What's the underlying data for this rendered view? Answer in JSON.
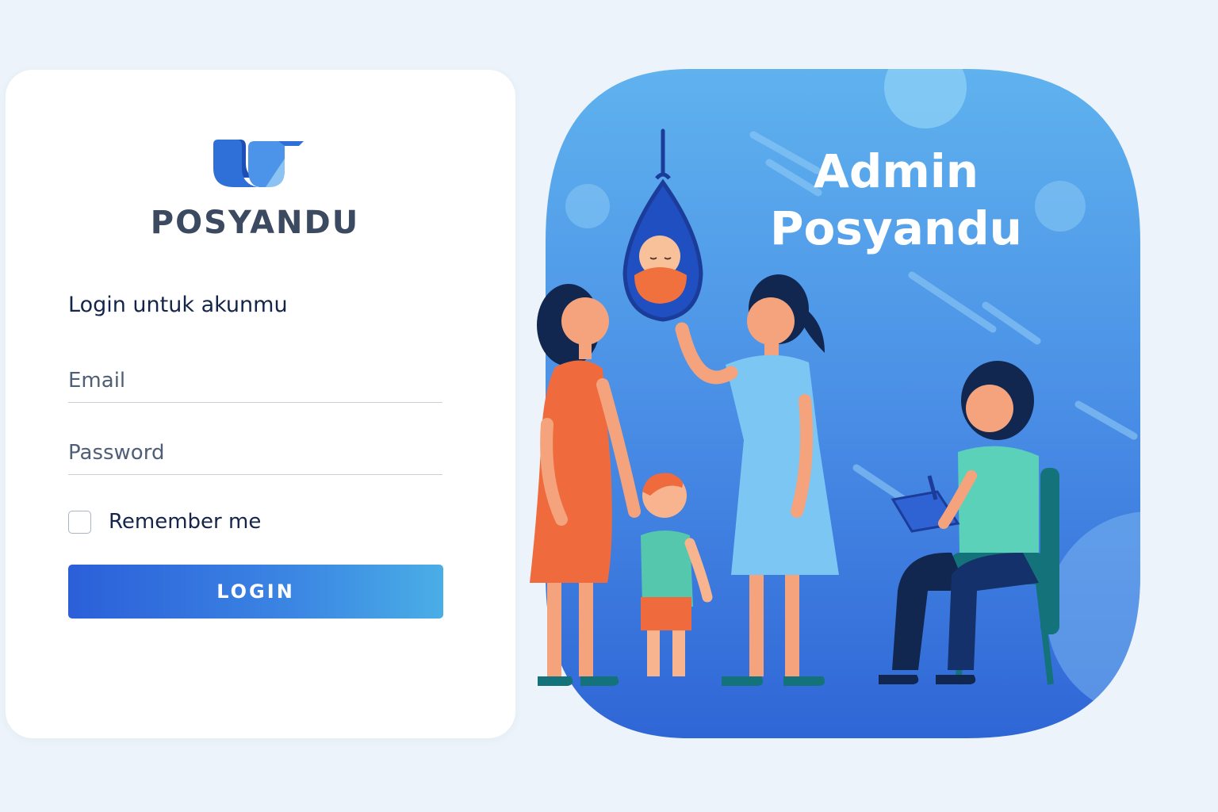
{
  "brand": {
    "name": "POSYANDU",
    "logo_icon": "posyandu-leaf-logo"
  },
  "form": {
    "subtitle": "Login untuk akunmu",
    "email_placeholder": "Email",
    "password_placeholder": "Password",
    "remember_label": "Remember me",
    "remember_checked": false,
    "login_label": "LOGIN"
  },
  "hero": {
    "title_line1": "Admin",
    "title_line2": "Posyandu",
    "illustration": "posyandu-family-weighing-illustration"
  },
  "colors": {
    "accent": "#2b5fd9",
    "accent_light": "#4aaee6",
    "page_background": "#ecf3fa",
    "text_dark": "#14244a"
  }
}
